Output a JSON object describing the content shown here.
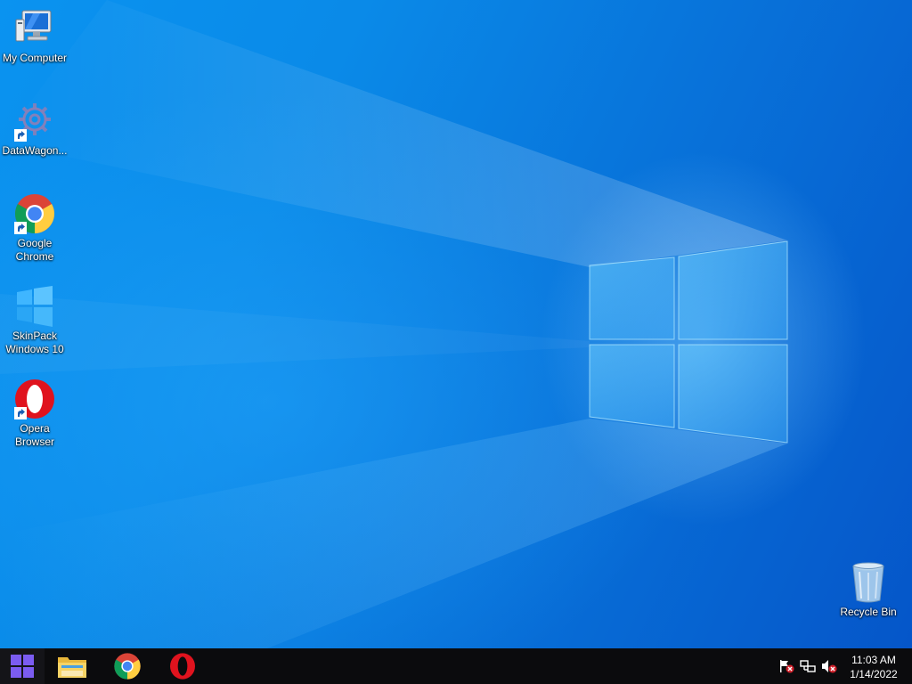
{
  "desktop": {
    "icons": [
      {
        "label": "My Computer",
        "icon": "computer-icon"
      },
      {
        "label": "DataWagon...",
        "icon": "datawagon-icon"
      },
      {
        "label": "Google Chrome",
        "icon": "chrome-icon"
      },
      {
        "label": "SkinPack Windows 10",
        "icon": "windows-logo-icon"
      },
      {
        "label": "Opera Browser",
        "icon": "opera-icon"
      },
      {
        "label": "Recycle Bin",
        "icon": "recycle-bin-icon"
      }
    ]
  },
  "taskbar": {
    "pinned": [
      {
        "name": "File Explorer",
        "icon": "folder-icon"
      },
      {
        "name": "Google Chrome",
        "icon": "chrome-icon"
      },
      {
        "name": "Opera",
        "icon": "opera-icon"
      }
    ],
    "tray": {
      "icons": [
        "action-center-flag-icon",
        "network-icon",
        "volume-muted-icon"
      ],
      "time": "11:03 AM",
      "date": "1/14/2022"
    }
  },
  "colors": {
    "accent": "#0078d7",
    "taskbar": "#0b0b0d",
    "start_logo": "#7b5cf0"
  }
}
